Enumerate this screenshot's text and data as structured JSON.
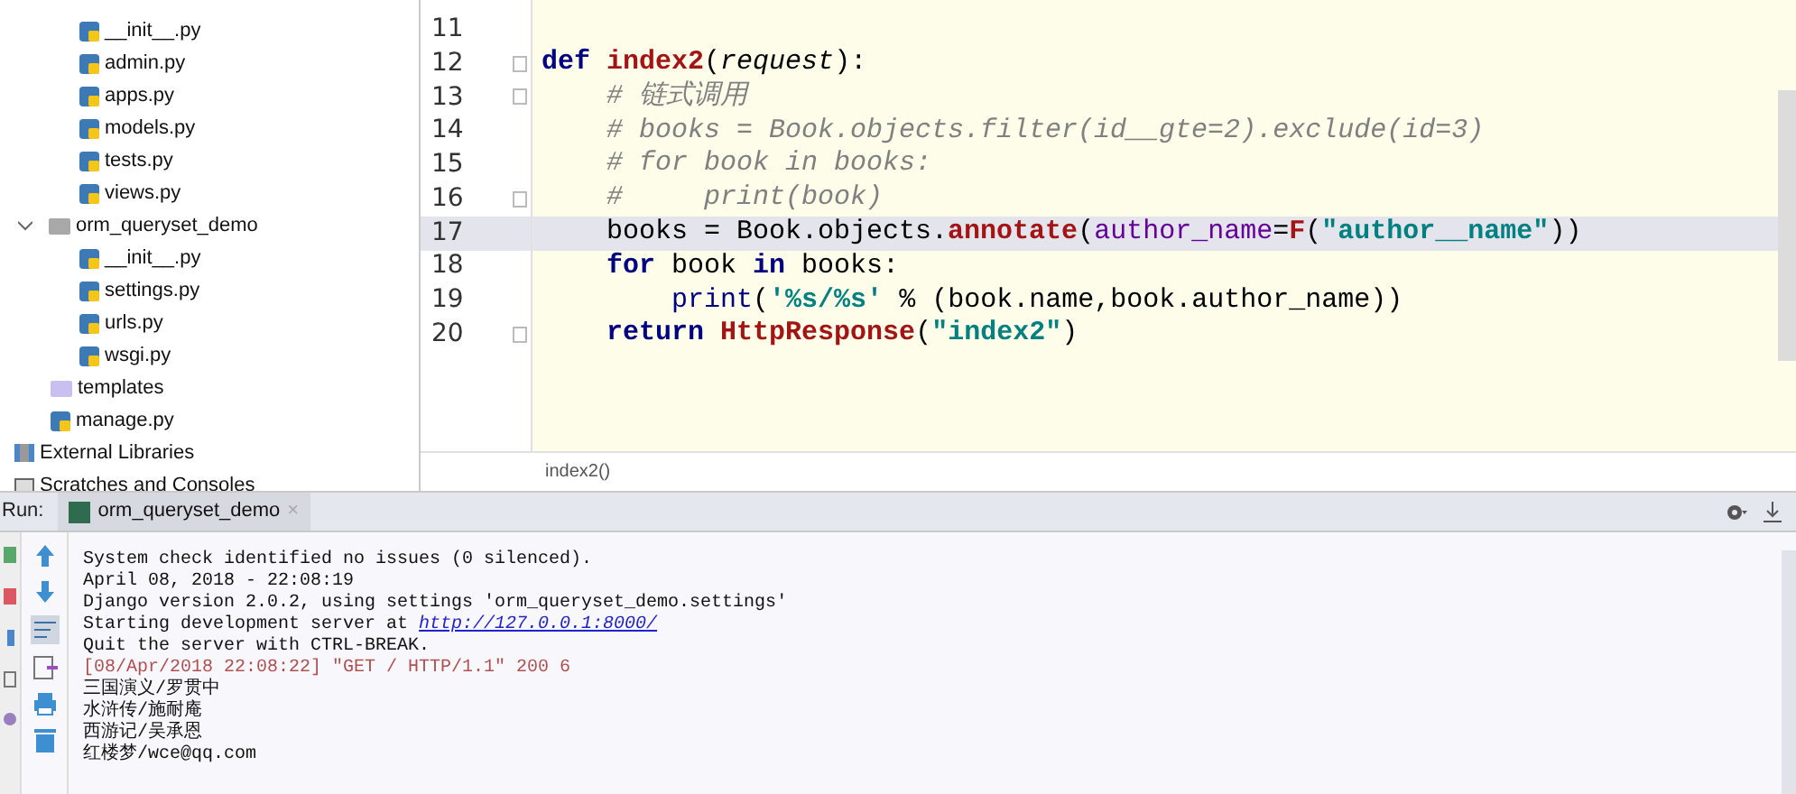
{
  "project_tree": {
    "children": [
      {
        "children": [
          {
            "label": "__init__.py",
            "kind": "python"
          },
          {
            "label": "admin.py",
            "kind": "python"
          },
          {
            "label": "apps.py",
            "kind": "python"
          },
          {
            "label": "models.py",
            "kind": "python"
          },
          {
            "label": "tests.py",
            "kind": "python"
          },
          {
            "label": "views.py",
            "kind": "python"
          }
        ]
      },
      {
        "label": "orm_queryset_demo",
        "kind": "folder",
        "expanded": true,
        "children": [
          {
            "label": "__init__.py",
            "kind": "python"
          },
          {
            "label": "settings.py",
            "kind": "python"
          },
          {
            "label": "urls.py",
            "kind": "python"
          },
          {
            "label": "wsgi.py",
            "kind": "python"
          }
        ]
      },
      {
        "label": "templates",
        "kind": "template_folder"
      },
      {
        "label": "manage.py",
        "kind": "python"
      }
    ]
  },
  "root_items": [
    {
      "label": "External Libraries",
      "kind": "libraries"
    },
    {
      "label": "Scratches and Consoles",
      "kind": "scratches"
    }
  ],
  "editor": {
    "lines": [
      {
        "number": "11",
        "current": false,
        "fold": false
      },
      {
        "number": "12",
        "current": false,
        "fold": true,
        "tokens": [
          {
            "text": "def ",
            "kind": "keyword"
          },
          {
            "text": "index2",
            "kind": "func"
          },
          {
            "text": "(",
            "kind": "plain"
          },
          {
            "text": "request",
            "kind": "param"
          },
          {
            "text": "):",
            "kind": "plain"
          }
        ]
      },
      {
        "number": "13",
        "current": false,
        "fold": true,
        "tokens": [
          {
            "text": "    # 链式调用",
            "kind": "comment"
          }
        ]
      },
      {
        "number": "14",
        "current": false,
        "fold": false,
        "tokens": [
          {
            "text": "    # books = Book.objects.filter(id__gte=2).exclude(id=3)",
            "kind": "comment"
          }
        ]
      },
      {
        "number": "15",
        "current": false,
        "fold": false,
        "tokens": [
          {
            "text": "    # for book in books:",
            "kind": "comment"
          }
        ]
      },
      {
        "number": "16",
        "current": false,
        "fold": true,
        "tokens": [
          {
            "text": "    #     print(book)",
            "kind": "comment"
          }
        ]
      },
      {
        "number": "17",
        "current": true,
        "fold": false,
        "tokens": [
          {
            "text": "    books = Book.objects.",
            "kind": "plain"
          },
          {
            "text": "annotate",
            "kind": "func"
          },
          {
            "text": "(",
            "kind": "plain"
          },
          {
            "text": "author_name",
            "kind": "named_arg"
          },
          {
            "text": "=",
            "kind": "plain"
          },
          {
            "text": "F",
            "kind": "func"
          },
          {
            "text": "(",
            "kind": "plain"
          },
          {
            "text": "\"author__name\"",
            "kind": "string"
          },
          {
            "text": "))",
            "kind": "plain"
          }
        ]
      },
      {
        "number": "18",
        "current": false,
        "fold": false,
        "tokens": [
          {
            "text": "    for ",
            "kind": "keyword"
          },
          {
            "text": "book ",
            "kind": "plain"
          },
          {
            "text": "in ",
            "kind": "keyword"
          },
          {
            "text": "books:",
            "kind": "plain"
          }
        ]
      },
      {
        "number": "19",
        "current": false,
        "fold": false,
        "tokens": [
          {
            "text": "        print",
            "kind": "builtin"
          },
          {
            "text": "(",
            "kind": "plain"
          },
          {
            "text": "'%s/%s'",
            "kind": "string"
          },
          {
            "text": " % (book.name,book.author_name))",
            "kind": "plain"
          }
        ]
      },
      {
        "number": "20",
        "current": false,
        "fold": true,
        "tokens": [
          {
            "text": "    return ",
            "kind": "keyword"
          },
          {
            "text": "HttpResponse",
            "kind": "func"
          },
          {
            "text": "(",
            "kind": "plain"
          },
          {
            "text": "\"index2\"",
            "kind": "string"
          },
          {
            "text": ")",
            "kind": "plain"
          }
        ]
      }
    ],
    "breadcrumb": "index2()"
  },
  "run_panel": {
    "label": "Run:",
    "tab": "orm_queryset_demo",
    "tab_close": "×",
    "output": [
      {
        "kind": "plain",
        "text": "System check identified no issues (0 silenced)."
      },
      {
        "kind": "plain",
        "text": "April 08, 2018 - 22:08:19"
      },
      {
        "kind": "plain",
        "text": "Django version 2.0.2, using settings 'orm_queryset_demo.settings'"
      },
      {
        "kind": "link",
        "text": "Starting development server at ",
        "link": "http://127.0.0.1:8000/"
      },
      {
        "kind": "plain",
        "text": "Quit the server with CTRL-BREAK."
      },
      {
        "kind": "log",
        "text": "[08/Apr/2018 22:08:22] \"GET / HTTP/1.1\" 200 6"
      },
      {
        "kind": "plain",
        "text": "三国演义/罗贯中"
      },
      {
        "kind": "plain",
        "text": "水浒传/施耐庵"
      },
      {
        "kind": "plain",
        "text": "西游记/吴承恩"
      },
      {
        "kind": "plain",
        "text": "红楼梦/wce@qq.com"
      }
    ]
  }
}
